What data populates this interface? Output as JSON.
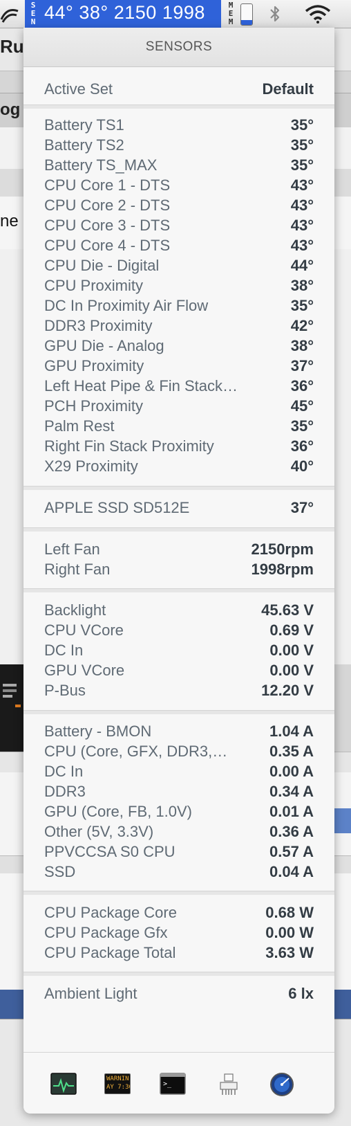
{
  "menubar": {
    "sensor_tag": "SEN",
    "readings": [
      "44°",
      "38°",
      "2150",
      "1998"
    ],
    "memory_tag": "MEM",
    "memory_fill_fraction": 0.25,
    "icons": [
      "app-icon",
      "bluetooth-icon",
      "wifi-icon"
    ]
  },
  "background_app": {
    "fragments": [
      "Ru",
      "og",
      "ne"
    ]
  },
  "popover": {
    "title": "SENSORS",
    "active_set": {
      "label": "Active Set",
      "value": "Default"
    },
    "temperatures": [
      {
        "label": "Battery TS1",
        "value": "35°"
      },
      {
        "label": "Battery TS2",
        "value": "35°"
      },
      {
        "label": "Battery TS_MAX",
        "value": "35°"
      },
      {
        "label": "CPU Core 1 - DTS",
        "value": "43°"
      },
      {
        "label": "CPU Core 2 - DTS",
        "value": "43°"
      },
      {
        "label": "CPU Core 3 - DTS",
        "value": "43°"
      },
      {
        "label": "CPU Core 4 - DTS",
        "value": "43°"
      },
      {
        "label": "CPU Die - Digital",
        "value": "44°"
      },
      {
        "label": "CPU Proximity",
        "value": "38°"
      },
      {
        "label": "DC In Proximity Air Flow",
        "value": "35°"
      },
      {
        "label": "DDR3 Proximity",
        "value": "42°"
      },
      {
        "label": "GPU Die - Analog",
        "value": "38°"
      },
      {
        "label": "GPU Proximity",
        "value": "37°"
      },
      {
        "label": "Left Heat Pipe & Fin Stack…",
        "value": "36°"
      },
      {
        "label": "PCH Proximity",
        "value": "45°"
      },
      {
        "label": "Palm Rest",
        "value": "35°"
      },
      {
        "label": "Right Fin Stack Proximity",
        "value": "36°"
      },
      {
        "label": "X29 Proximity",
        "value": "40°"
      }
    ],
    "disks": [
      {
        "label": "APPLE SSD SD512E",
        "value": "37°"
      }
    ],
    "fans": [
      {
        "label": "Left Fan",
        "value": "2150rpm"
      },
      {
        "label": "Right Fan",
        "value": "1998rpm"
      }
    ],
    "voltages": [
      {
        "label": "Backlight",
        "value": "45.63 V"
      },
      {
        "label": "CPU VCore",
        "value": "0.69 V"
      },
      {
        "label": "DC In",
        "value": "0.00 V"
      },
      {
        "label": "GPU VCore",
        "value": "0.00 V"
      },
      {
        "label": "P-Bus",
        "value": "12.20 V"
      }
    ],
    "currents": [
      {
        "label": "Battery - BMON",
        "value": "1.04 A"
      },
      {
        "label": "CPU (Core, GFX, DDR3,…",
        "value": "0.35 A"
      },
      {
        "label": "DC In",
        "value": "0.00 A"
      },
      {
        "label": "DDR3",
        "value": "0.34 A"
      },
      {
        "label": "GPU (Core, FB, 1.0V)",
        "value": "0.01 A"
      },
      {
        "label": "Other (5V, 3.3V)",
        "value": "0.36 A"
      },
      {
        "label": "PPVCCSA S0 CPU",
        "value": "0.57 A"
      },
      {
        "label": "SSD",
        "value": "0.04 A"
      }
    ],
    "power": [
      {
        "label": "CPU Package Core",
        "value": "0.68 W"
      },
      {
        "label": "CPU Package Gfx",
        "value": "0.00 W"
      },
      {
        "label": "CPU Package Total",
        "value": "3.63 W"
      }
    ],
    "light": [
      {
        "label": "Ambient Light",
        "value": "6 lx"
      }
    ],
    "footer_tools": {
      "console_text": "WARNIN\nAY 7:36",
      "names": [
        "activity-monitor-icon",
        "console-icon",
        "terminal-icon",
        "system-information-icon",
        "network-utility-icon"
      ]
    }
  }
}
